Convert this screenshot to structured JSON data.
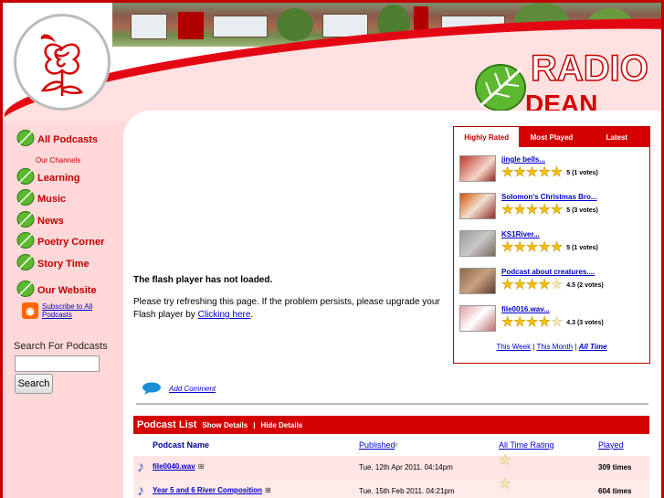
{
  "brand": {
    "line1": "RADIO",
    "line2": "DEAN HOLE"
  },
  "nav": {
    "all_podcasts": "All Podcasts",
    "our_channels": "Our Channels",
    "learning": "Learning",
    "music": "Music",
    "news": "News",
    "poetry_corner": "Poetry Corner",
    "story_time": "Story Time",
    "our_website": "Our Website",
    "subscribe": "Subscribe to All Podcasts"
  },
  "search": {
    "label": "Search For Podcasts",
    "value": "",
    "button": "Search"
  },
  "flash": {
    "title": "The flash player has not loaded.",
    "text": "Please try refreshing this page. If the problem persists, please upgrade your Flash player by ",
    "link": "Clicking here",
    "period": "."
  },
  "comment": {
    "label": "Add Comment"
  },
  "rated": {
    "tabs": [
      "Highly Rated",
      "Most Played",
      "Latest"
    ],
    "items": [
      {
        "title": "jingle bells...",
        "rating": 5,
        "votes": "5 (1 votes)"
      },
      {
        "title": "Solomon's Christmas Bro...",
        "rating": 5,
        "votes": "5 (3 votes)"
      },
      {
        "title": "KS1River...",
        "rating": 5,
        "votes": "5 (1 votes)"
      },
      {
        "title": "Podcast about creatures....",
        "rating": 4.5,
        "votes": "4.5 (2 votes)"
      },
      {
        "title": "file0016.wav...",
        "rating": 4.3,
        "votes": "4.3 (3 votes)"
      }
    ],
    "footer": {
      "week": "This Week",
      "sep1": " | ",
      "month": "This Month",
      "sep2": " | ",
      "all": "All Time"
    }
  },
  "podcast_list": {
    "title": "Podcast List",
    "show_details": "Show Details",
    "sep": "|",
    "hide_details": "Hide Details",
    "columns": {
      "name": "Podcast Name",
      "published": "Published",
      "rating": "All Time Rating",
      "played": "Played"
    },
    "rows": [
      {
        "name": "file0040.wav",
        "published": "Tue. 12th Apr 2011. 04:14pm",
        "rating": 0,
        "played": "309 times"
      },
      {
        "name": "Year 5 and 6 River Composition",
        "published": "Tue. 15th Feb 2011. 04:21pm",
        "rating": 0,
        "played": "604 times"
      }
    ]
  },
  "colors": {
    "accent": "#d40000",
    "background": "#ffd9d9",
    "link": "#0000cc"
  }
}
